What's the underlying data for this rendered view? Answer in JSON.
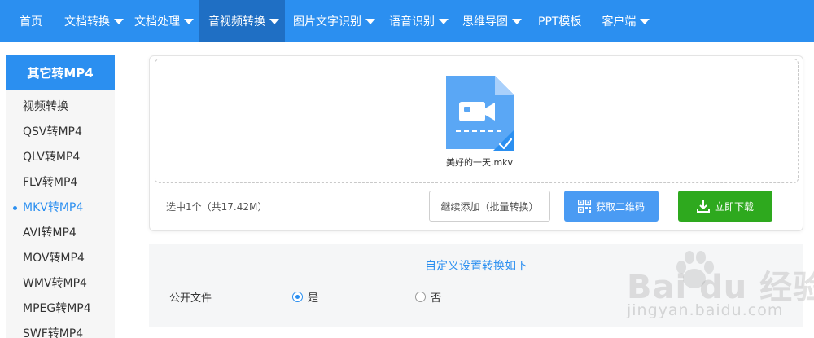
{
  "nav": {
    "items": [
      {
        "label": "首页",
        "dropdown": false
      },
      {
        "label": "文档转换",
        "dropdown": true
      },
      {
        "label": "文档处理",
        "dropdown": true
      },
      {
        "label": "音视频转换",
        "dropdown": true,
        "active": true
      },
      {
        "label": "图片文字识别",
        "dropdown": true
      },
      {
        "label": "语音识别",
        "dropdown": true
      },
      {
        "label": "思维导图",
        "dropdown": true
      },
      {
        "label": "PPT模板",
        "dropdown": false
      },
      {
        "label": "客户端",
        "dropdown": true
      }
    ]
  },
  "sidebar": {
    "header": "其它转MP4",
    "items": [
      {
        "label": "视频转换"
      },
      {
        "label": "QSV转MP4"
      },
      {
        "label": "QLV转MP4"
      },
      {
        "label": "FLV转MP4"
      },
      {
        "label": "MKV转MP4",
        "active": true
      },
      {
        "label": "AVI转MP4"
      },
      {
        "label": "MOV转MP4"
      },
      {
        "label": "WMV转MP4"
      },
      {
        "label": "MPEG转MP4"
      },
      {
        "label": "SWF转MP4"
      }
    ]
  },
  "upload": {
    "file_name": "美好的一天.mkv",
    "selection_info": "选中1个（共17.42M）",
    "add_more_label": "继续添加（批量转换）",
    "qr_label": "获取二维码",
    "download_label": "立即下载"
  },
  "settings": {
    "title": "自定义设置转换如下",
    "public_label": "公开文件",
    "option_yes": "是",
    "option_no": "否",
    "selected": "是"
  },
  "watermark": {
    "brand": "Bai du 经验",
    "url": "jingyan.baidu.com"
  },
  "colors": {
    "primary": "#2b8ff0",
    "nav_active": "#1f6fc4",
    "download_green": "#2ea91e",
    "qr_blue": "#4a9bf3",
    "file_icon": "#5aa7f5"
  }
}
